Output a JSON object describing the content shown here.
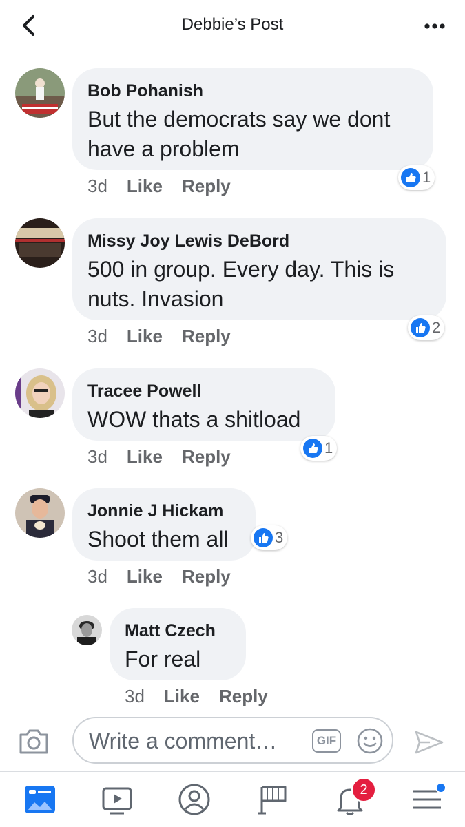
{
  "header": {
    "title": "Debbie’s Post"
  },
  "comments": [
    {
      "author": "Bob Pohanish",
      "lines": [
        "But the democrats say we dont",
        "have a problem"
      ],
      "time": "3d",
      "like": "Like",
      "reply": "Reply",
      "reactions": "1"
    },
    {
      "author": "Missy Joy Lewis DeBord",
      "lines": [
        "500 in group.   Every day. This is",
        "nuts. Invasion"
      ],
      "time": "3d",
      "like": "Like",
      "reply": "Reply",
      "reactions": "2"
    },
    {
      "author": "Tracee Powell",
      "lines": [
        "WOW thats a shitload"
      ],
      "time": "3d",
      "like": "Like",
      "reply": "Reply",
      "reactions": "1"
    },
    {
      "author": "Jonnie J Hickam",
      "lines": [
        "Shoot them all"
      ],
      "time": "3d",
      "like": "Like",
      "reply": "Reply",
      "reactions": "3"
    },
    {
      "author": "Matt Czech",
      "lines": [
        "For real"
      ],
      "time": "3d",
      "like": "Like",
      "reply": "Reply"
    }
  ],
  "composer": {
    "placeholder": "Write a comment…",
    "gif_label": "GIF"
  },
  "tabbar": {
    "notifications_badge": "2"
  },
  "colors": {
    "accent": "#1877f2",
    "bubble": "#f0f2f5",
    "badge": "#e41e3f"
  }
}
